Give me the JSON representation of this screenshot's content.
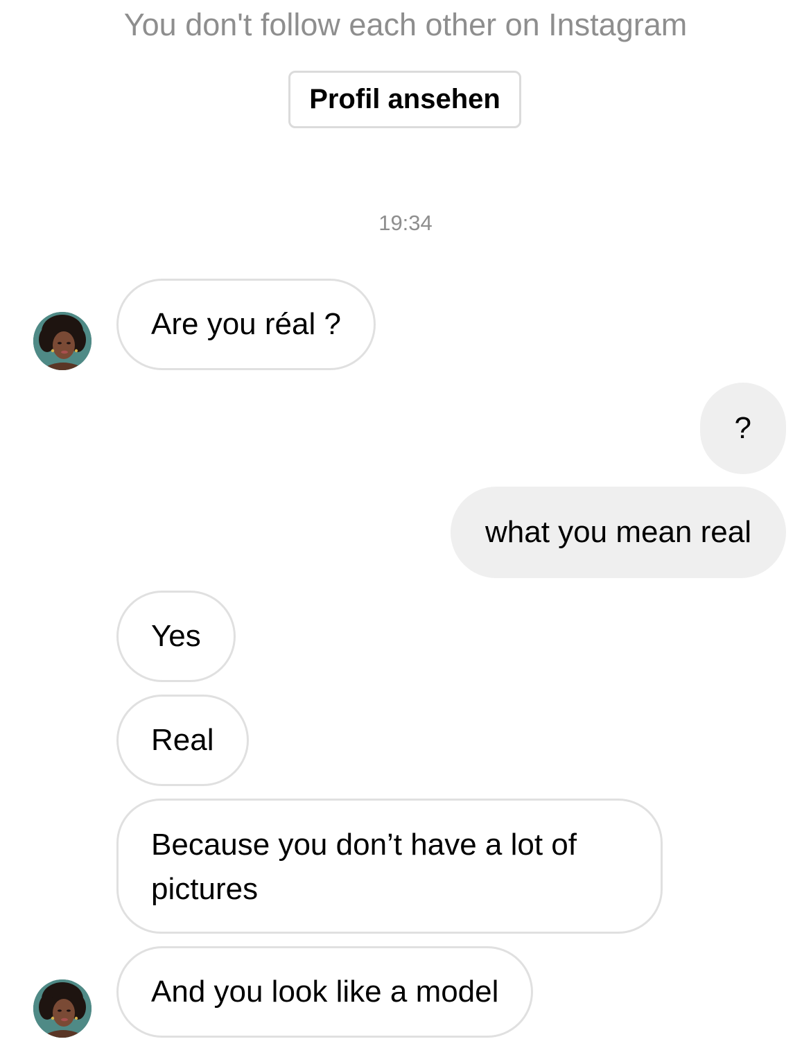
{
  "header": {
    "follow_status": "You don't follow each other on Instagram",
    "profile_button_label": "Profil ansehen"
  },
  "conversation": {
    "timestamp": "19:34",
    "messages": [
      {
        "sender": "them",
        "text": "Are you réal ?"
      },
      {
        "sender": "me",
        "text": "?"
      },
      {
        "sender": "me",
        "text": "what you mean real"
      },
      {
        "sender": "them",
        "text": "Yes"
      },
      {
        "sender": "them",
        "text": "Real"
      },
      {
        "sender": "them",
        "text": "Because you don’t have a lot of pictures"
      },
      {
        "sender": "them",
        "text": "And you look like a model"
      }
    ]
  },
  "colors": {
    "incoming_bubble_border": "#e0e0e0",
    "outgoing_bubble_bg": "#efefef",
    "secondary_text": "#8e8e8e"
  }
}
